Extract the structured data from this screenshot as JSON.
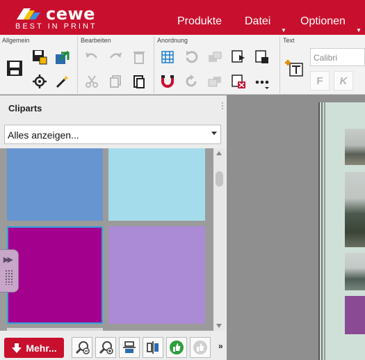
{
  "header": {
    "brand": "cewe",
    "tagline": "BEST IN PRINT",
    "menu": [
      "Produkte",
      "Datei",
      "Optionen"
    ]
  },
  "ribbon": {
    "groups": [
      "Allgemein",
      "Bearbeiten",
      "Anordnung",
      "Text"
    ],
    "font_name": "Calibri",
    "format_buttons": [
      "F",
      "K"
    ]
  },
  "panel": {
    "title": "Cliparts",
    "filter_value": "Alles anzeigen...",
    "swatches": [
      {
        "color": "#6795cf",
        "selected": false
      },
      {
        "color": "#a4dcec",
        "selected": false
      },
      {
        "color": "#a3008e",
        "selected": true
      },
      {
        "color": "#ab8ad6",
        "selected": false
      }
    ],
    "more_button": "Mehr..."
  },
  "colors": {
    "brand_red": "#c8102e",
    "selection_blue": "#2da2e0"
  },
  "icons": {
    "ribbon": [
      "save-icon",
      "save-as-icon",
      "export-icon",
      "settings-icon",
      "magic-wand-icon",
      "undo-icon",
      "redo-icon",
      "delete-icon",
      "cut-icon",
      "copy-icon",
      "paste-icon",
      "grid-icon",
      "rotate-icon",
      "bring-forward-icon",
      "send-to-back-icon",
      "magnet-icon",
      "flip-icon",
      "send-backward-icon",
      "remove-image-icon",
      "save-image-icon",
      "more-options-icon",
      "add-text-icon"
    ],
    "bottom": [
      "zoom-out-icon",
      "zoom-in-icon",
      "align-vertical-icon",
      "align-horizontal-icon",
      "thumbs-up-icon",
      "thumbs-up-disabled-icon"
    ]
  }
}
